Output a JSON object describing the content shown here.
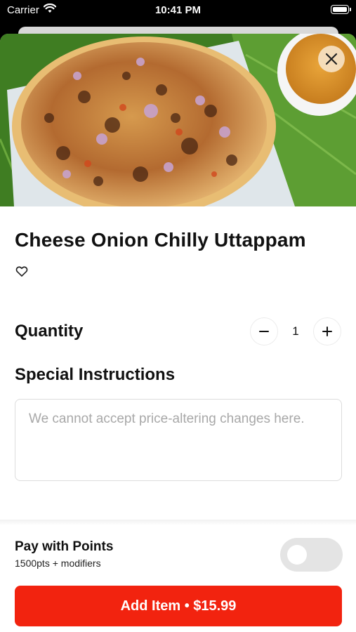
{
  "status_bar": {
    "carrier": "Carrier",
    "time": "10:41 PM"
  },
  "item": {
    "title": "Cheese Onion Chilly Uttappam",
    "image_icon": "food-photo"
  },
  "quantity": {
    "label": "Quantity",
    "value": "1",
    "minus_symbol": "−",
    "plus_symbol": "+"
  },
  "instructions": {
    "label": "Special Instructions",
    "placeholder": "We cannot accept price-altering changes here."
  },
  "points": {
    "title": "Pay with Points",
    "subtitle": "1500pts + modifiers",
    "enabled": false
  },
  "cta": {
    "label": "Add Item • $15.99"
  },
  "colors": {
    "accent": "#f2230f",
    "toggle_off": "#e4e4e4",
    "close_button_bg": "#f6e2c4"
  }
}
